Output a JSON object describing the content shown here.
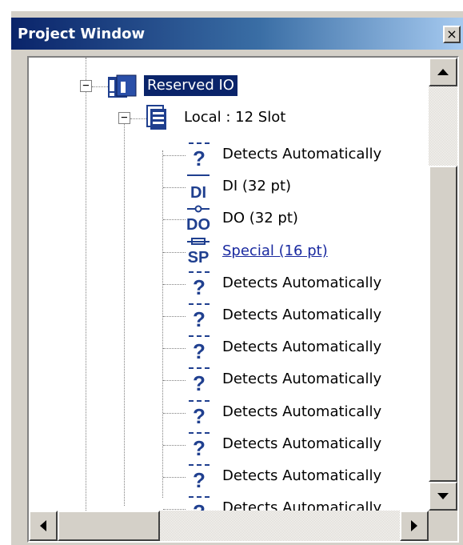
{
  "window": {
    "title": "Project Window",
    "close_glyph": "×"
  },
  "tree": {
    "root": {
      "label": "Reserved IO",
      "icon": "reserved-io-icon",
      "expander": "−",
      "selected": true
    },
    "base": {
      "label": "Local : 12 Slot",
      "icon": "local-base-icon",
      "expander": "−"
    },
    "slots": [
      {
        "label": "Detects Automatically",
        "icon": "question-icon"
      },
      {
        "label": "DI (32 pt)",
        "icon": "di-module-icon",
        "code": "DI"
      },
      {
        "label": "DO (32 pt)",
        "icon": "do-module-icon",
        "code": "DO"
      },
      {
        "label": "Special (16 pt)",
        "icon": "sp-module-icon",
        "code": "SP",
        "link": true
      },
      {
        "label": "Detects Automatically",
        "icon": "question-icon"
      },
      {
        "label": "Detects Automatically",
        "icon": "question-icon"
      },
      {
        "label": "Detects Automatically",
        "icon": "question-icon"
      },
      {
        "label": "Detects Automatically",
        "icon": "question-icon"
      },
      {
        "label": "Detects Automatically",
        "icon": "question-icon"
      },
      {
        "label": "Detects Automatically",
        "icon": "question-icon"
      },
      {
        "label": "Detects Automatically",
        "icon": "question-icon"
      },
      {
        "label": "Detects Automatically",
        "icon": "question-icon"
      }
    ]
  },
  "scrollbars": {
    "vertical_thumb_visible_fraction": 0.8,
    "horizontal_thumb_visible_fraction": 0.3
  },
  "colors": {
    "selection_bg": "#0a246a",
    "link": "#1a2aa0",
    "icon_blue": "#1f3f8f"
  }
}
